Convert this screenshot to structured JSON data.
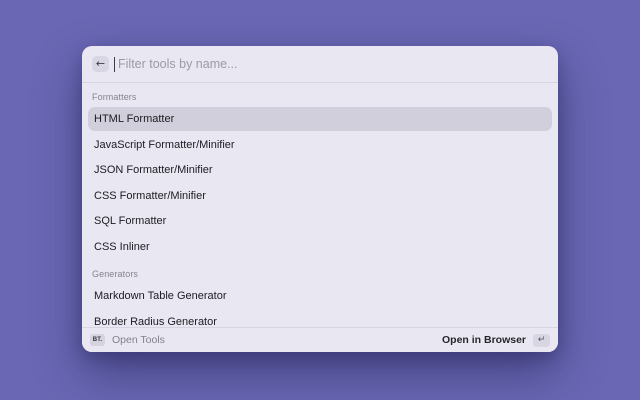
{
  "palette": {
    "search": {
      "placeholder": "Filter tools by name...",
      "back_icon": "←"
    },
    "sections": [
      {
        "label": "Formatters",
        "items": [
          {
            "label": "HTML Formatter",
            "selected": true
          },
          {
            "label": "JavaScript Formatter/Minifier",
            "selected": false
          },
          {
            "label": "JSON Formatter/Minifier",
            "selected": false
          },
          {
            "label": "CSS Formatter/Minifier",
            "selected": false
          },
          {
            "label": "SQL Formatter",
            "selected": false
          },
          {
            "label": "CSS Inliner",
            "selected": false
          }
        ]
      },
      {
        "label": "Generators",
        "items": [
          {
            "label": "Markdown Table Generator",
            "selected": false
          },
          {
            "label": "Border Radius Generator",
            "selected": false
          }
        ]
      }
    ],
    "footer": {
      "app_badge": "BT.",
      "app_label": "Open Tools",
      "action_label": "Open in Browser",
      "enter_key_icon": "↵"
    },
    "colors": {
      "background": "#6A68B4",
      "panel": "#E8E7F2",
      "selected_row": "#D0CFDB"
    }
  }
}
